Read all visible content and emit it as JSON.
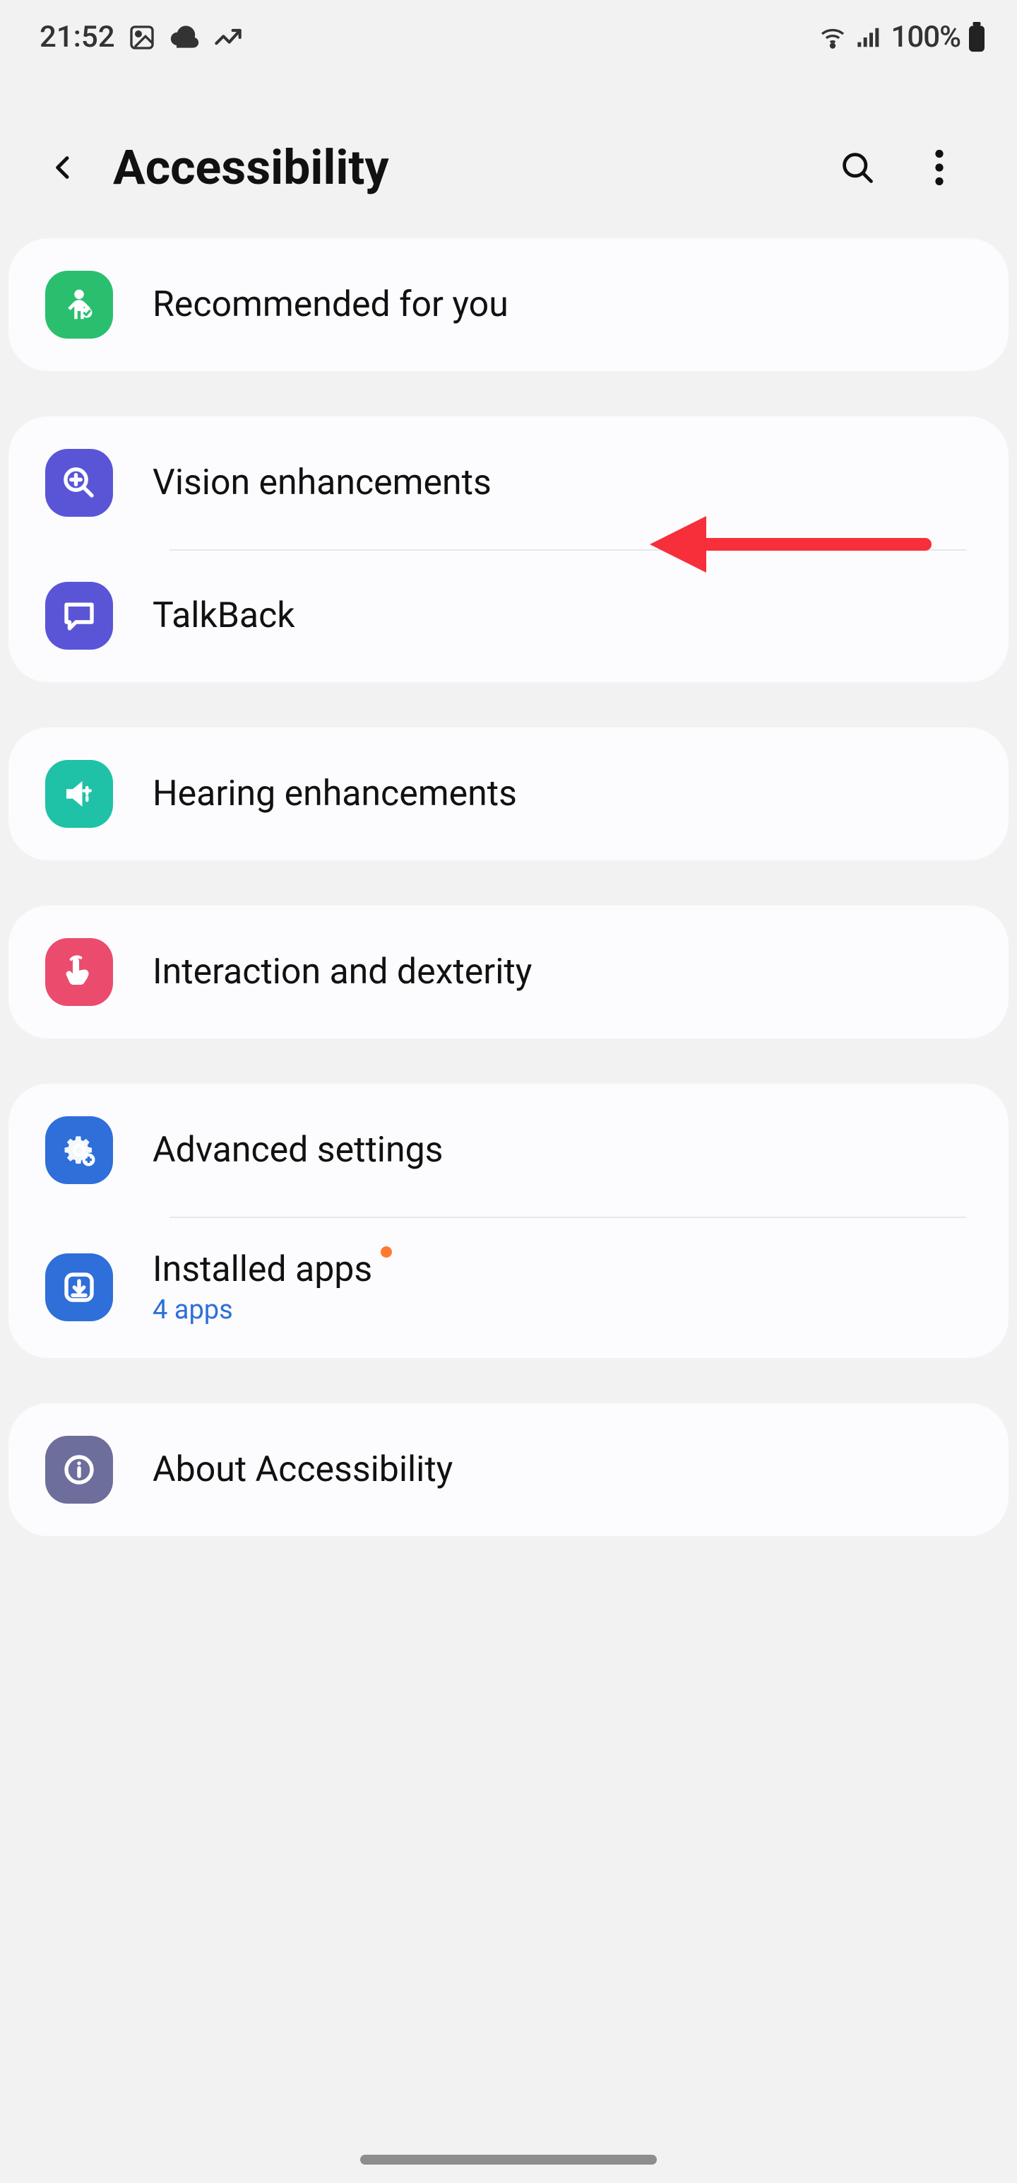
{
  "status": {
    "time": "21:52",
    "battery_pct": "100%"
  },
  "header": {
    "title": "Accessibility"
  },
  "groups": [
    {
      "items": [
        {
          "id": "recommended",
          "label": "Recommended for you"
        }
      ]
    },
    {
      "items": [
        {
          "id": "vision",
          "label": "Vision enhancements"
        },
        {
          "id": "talkback",
          "label": "TalkBack"
        }
      ]
    },
    {
      "items": [
        {
          "id": "hearing",
          "label": "Hearing enhancements"
        }
      ]
    },
    {
      "items": [
        {
          "id": "interaction",
          "label": "Interaction and dexterity"
        }
      ]
    },
    {
      "items": [
        {
          "id": "advanced",
          "label": "Advanced settings"
        },
        {
          "id": "installed",
          "label": "Installed apps",
          "sub": "4 apps",
          "badge": true
        }
      ]
    },
    {
      "items": [
        {
          "id": "about",
          "label": "About Accessibility"
        }
      ]
    }
  ]
}
